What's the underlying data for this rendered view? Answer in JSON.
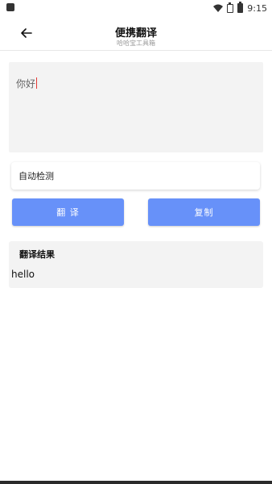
{
  "status_bar": {
    "time": "9:15"
  },
  "toolbar": {
    "title": "便携翻译",
    "subtitle": "哈哈宝工具箱"
  },
  "input": {
    "value": "你好"
  },
  "language": {
    "selected": "自动检测"
  },
  "buttons": {
    "translate": "翻 译",
    "copy": "复制"
  },
  "result": {
    "header": "翻译结果",
    "text": "hello"
  },
  "colors": {
    "accent": "#6791f9",
    "panel": "#f3f3f3",
    "caret": "#e53935"
  }
}
